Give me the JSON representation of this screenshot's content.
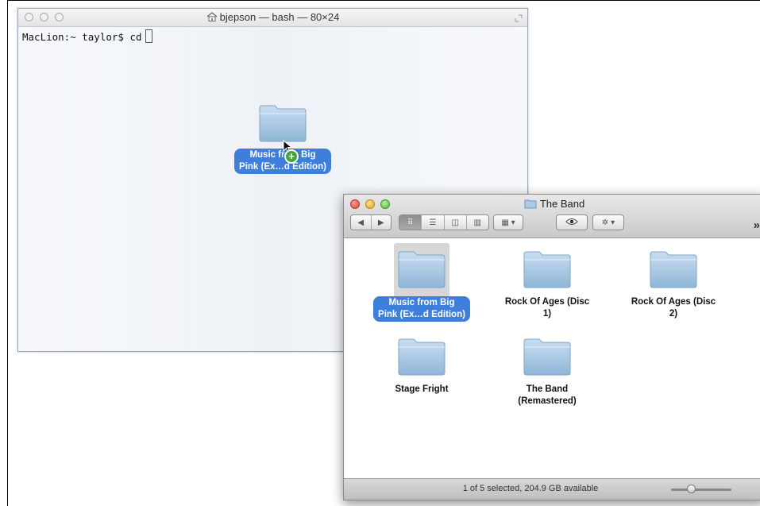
{
  "terminal": {
    "title": "bjepson — bash — 80×24",
    "prompt": "MacLion:~ taylor$ cd",
    "drag_item_label_line1": "Music from Big",
    "drag_item_label_line2": "Pink (Ex…d Edition)",
    "copy_badge": "+"
  },
  "finder": {
    "title": "The Band",
    "items": [
      {
        "line1": "Music from Big",
        "line2": "Pink (Ex…d Edition)",
        "selected": true
      },
      {
        "line1": "Rock Of Ages (Disc",
        "line2": "1)",
        "selected": false
      },
      {
        "line1": "Rock Of Ages (Disc",
        "line2": "2)",
        "selected": false
      },
      {
        "line1": "Stage Fright",
        "line2": "",
        "selected": false
      },
      {
        "line1": "The Band",
        "line2": "(Remastered)",
        "selected": false
      }
    ],
    "status": "1 of 5 selected, 204.9 GB available",
    "overflow_chevron": "»",
    "icons": [
      "back-icon",
      "forward-icon",
      "icon-view-icon",
      "list-view-icon",
      "column-view-icon",
      "coverflow-view-icon",
      "arrange-icon",
      "quick-look-eye-icon",
      "action-gear-icon"
    ],
    "folder_color": "#a9cbe6"
  }
}
